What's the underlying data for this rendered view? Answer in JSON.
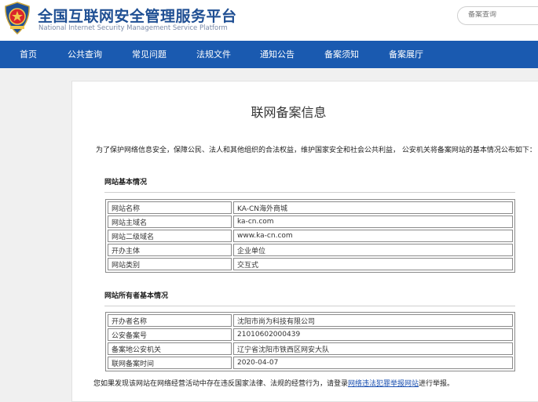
{
  "header": {
    "title": "全国互联网安全管理服务平台",
    "subtitle": "National Internet Security Management Service Platform",
    "search_placeholder": "备案查询",
    "emblem_icon": "police-emblem-icon"
  },
  "nav": {
    "items": [
      {
        "label": "首页"
      },
      {
        "label": "公共查询"
      },
      {
        "label": "常见问题"
      },
      {
        "label": "法规文件"
      },
      {
        "label": "通知公告"
      },
      {
        "label": "备案须知"
      },
      {
        "label": "备案展厅"
      }
    ]
  },
  "content": {
    "title": "联网备案信息",
    "intro": "为了保护网络信息安全，保障公民、法人和其他组织的合法权益，维护国家安全和社会公共利益， 公安机关将备案网站的基本情况公布如下：",
    "site_section": {
      "title": "网站基本情况",
      "rows": [
        {
          "key": "网站名称",
          "value": "KA-CN海外商城"
        },
        {
          "key": "网站主域名",
          "value": "ka-cn.com"
        },
        {
          "key": "网站二级域名",
          "value": "www.ka-cn.com"
        },
        {
          "key": "开办主体",
          "value": "企业单位"
        },
        {
          "key": "网站类别",
          "value": "交互式"
        }
      ]
    },
    "owner_section": {
      "title": "网站所有者基本情况",
      "rows": [
        {
          "key": "开办者名称",
          "value": "沈阳市尚为科技有限公司"
        },
        {
          "key": "公安备案号",
          "value": "21010602000439"
        },
        {
          "key": "备案地公安机关",
          "value": "辽宁省沈阳市铁西区网安大队"
        },
        {
          "key": "联网备案时间",
          "value": "2020-04-07"
        }
      ]
    },
    "footer": {
      "prefix": "您如果发现该网站在网络经营活动中存在违反国家法律、法规的经营行为，请登录",
      "link": "网络违法犯罪举报网站",
      "suffix": "进行举报。"
    }
  },
  "colors": {
    "nav_bg": "#1a5ab0",
    "title_blue": "#1f4f93",
    "link_blue": "#1a4fb0",
    "page_bg": "#f0f0f0"
  }
}
